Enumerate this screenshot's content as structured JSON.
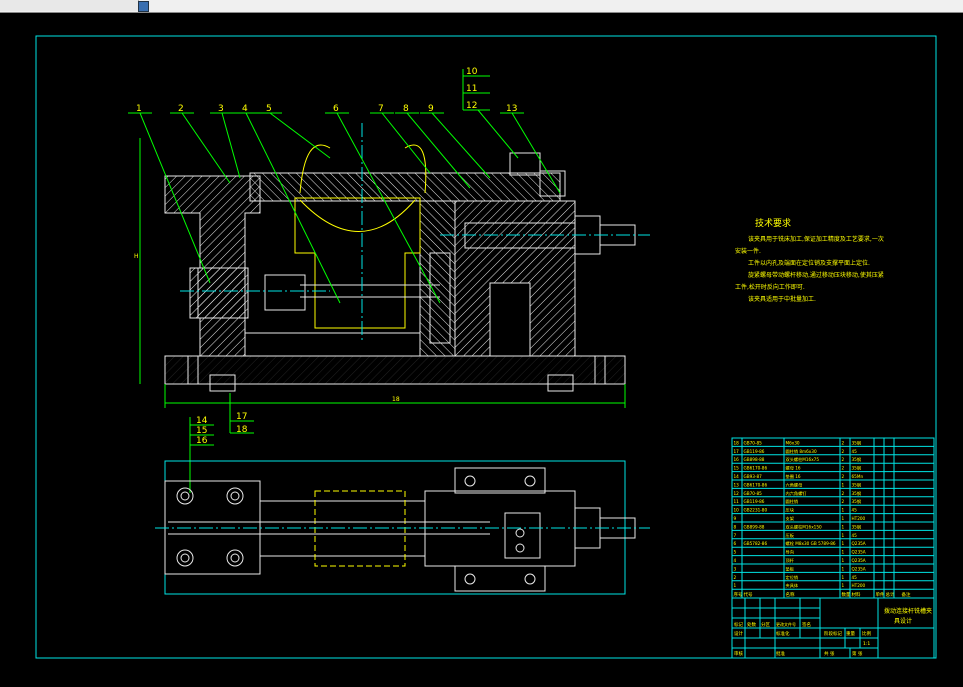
{
  "window": {
    "tab_label": "",
    "icon": "drawing-icon"
  },
  "balloons": {
    "top": [
      "1",
      "2",
      "3",
      "4",
      "5",
      "6",
      "7",
      "8",
      "9",
      "13"
    ],
    "stack_top": [
      "10",
      "11",
      "12"
    ],
    "stack_bottom_left": [
      "14",
      "15",
      "16"
    ],
    "stack_bottom_mid": [
      "17",
      "18"
    ]
  },
  "technical_requirements": {
    "title": "技术要求",
    "lines": [
      "该夹具用于铣床加工,保证加工精度及工艺要求,一次",
      "安装一件.",
      "工件以内孔及端面在定位销及支撑平面上定位.",
      "旋紧螺母带动螺杆移动,通过移动压块移动,使其压紧",
      "工件,松开时反向工作即可.",
      "该夹具适用于中批量加工."
    ]
  },
  "parts_list": {
    "rows": [
      {
        "no": "18",
        "code": "GB70-85",
        "name": "M6x30",
        "qty": "2",
        "mat": "35钢"
      },
      {
        "no": "17",
        "code": "GB119-86",
        "name": "圆柱销 8m6x30",
        "qty": "2",
        "mat": "45"
      },
      {
        "no": "16",
        "code": "GB898-88",
        "name": "双头螺柱M16x75",
        "qty": "2",
        "mat": "35钢"
      },
      {
        "no": "15",
        "code": "GB6170-86",
        "name": "螺母 16",
        "qty": "2",
        "mat": "35钢"
      },
      {
        "no": "14",
        "code": "GB93-87",
        "name": "垫圈 16",
        "qty": "2",
        "mat": "65Mn"
      },
      {
        "no": "13",
        "code": "GB6170-86",
        "name": "六角螺母",
        "qty": "1",
        "mat": "35钢"
      },
      {
        "no": "12",
        "code": "GB70-85",
        "name": "内六角螺钉",
        "qty": "2",
        "mat": "35钢"
      },
      {
        "no": "11",
        "code": "GB119-86",
        "name": "圆柱销",
        "qty": "2",
        "mat": "35钢"
      },
      {
        "no": "10",
        "code": "GB2231-80",
        "name": "压块",
        "qty": "1",
        "mat": "45"
      },
      {
        "no": "9",
        "code": "",
        "name": "支架",
        "qty": "1",
        "mat": "HT200"
      },
      {
        "no": "8",
        "code": "GB899-88",
        "name": "双头螺柱M16x150",
        "qty": "1",
        "mat": "35钢"
      },
      {
        "no": "7",
        "code": "",
        "name": "压板",
        "qty": "1",
        "mat": "45"
      },
      {
        "no": "6",
        "code": "GB5782-86",
        "name": "螺栓 M8x30 GB 5789-86",
        "qty": "1",
        "mat": "Q235A"
      },
      {
        "no": "5",
        "code": "",
        "name": "导向",
        "qty": "1",
        "mat": "Q235A"
      },
      {
        "no": "4",
        "code": "",
        "name": "顶杆",
        "qty": "1",
        "mat": "Q235A"
      },
      {
        "no": "3",
        "code": "",
        "name": "垫板",
        "qty": "1",
        "mat": "Q235A"
      },
      {
        "no": "2",
        "code": "",
        "name": "定位销",
        "qty": "1",
        "mat": "45"
      },
      {
        "no": "1",
        "code": "",
        "name": "夹具体",
        "qty": "1",
        "mat": "HT200"
      }
    ],
    "header": {
      "no": "序号",
      "code": "代号",
      "name": "名称",
      "qty": "数量",
      "mat": "材料",
      "unit_wt": "单件",
      "total_wt": "总计",
      "weight": "重量",
      "note": "备注"
    }
  },
  "title_block": {
    "title_line1": "拨动连接杆铣槽夹",
    "title_line2": "具设计",
    "cells": {
      "mark": "标记",
      "count": "处数",
      "zone": "分区",
      "change_doc": "更改文件号",
      "sign": "签名",
      "date": "年月日",
      "design": "设计",
      "standard": "标准化",
      "review": "审核",
      "process": "工艺",
      "approve": "批准",
      "stage_mark": "阶段标记",
      "weight": "重量",
      "ratio": "比例",
      "scale": "1:1",
      "sheets": "共 张",
      "sheet": "第 张"
    }
  },
  "dimensions": {
    "overall_width": "18",
    "height": "H"
  }
}
